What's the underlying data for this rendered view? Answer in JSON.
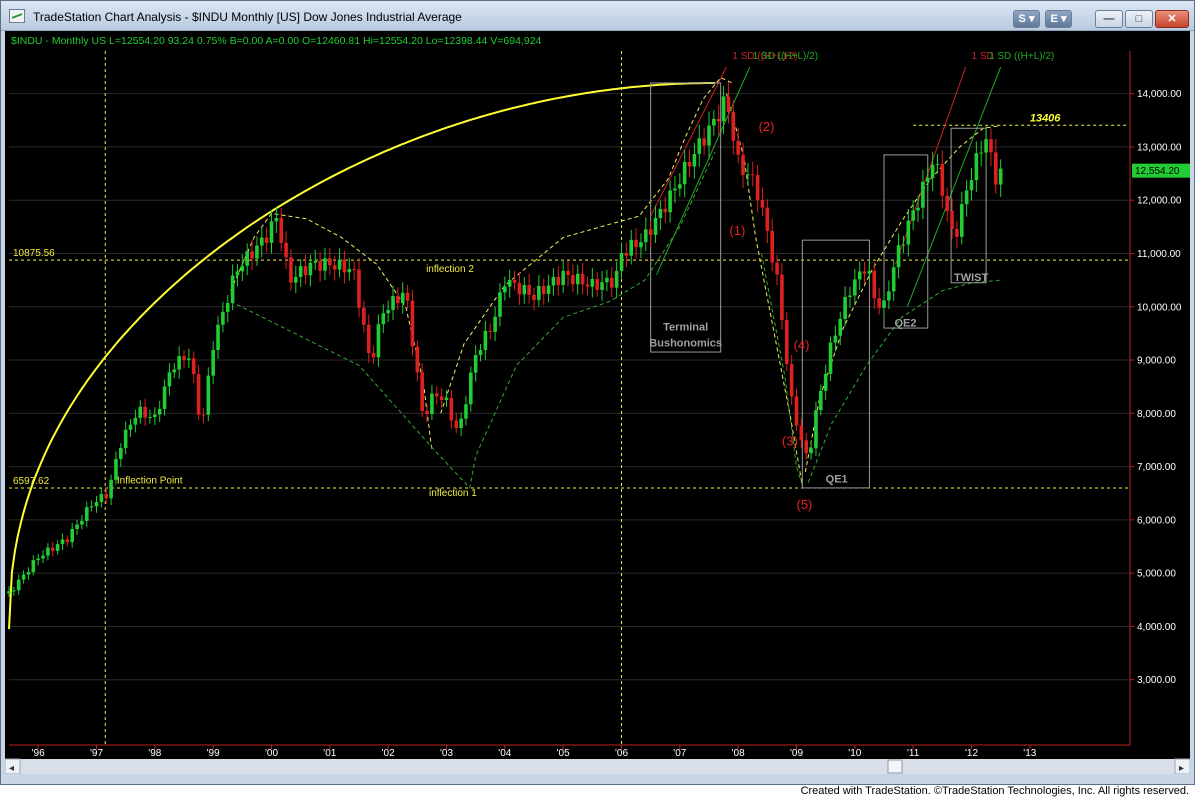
{
  "window": {
    "title": "TradeStation Chart Analysis - $INDU Monthly [US] Dow Jones Industrial Average",
    "buttons": {
      "s_label": "S",
      "e_label": "E"
    }
  },
  "header": {
    "info": "$INDU - Monthly  US  L=12554.20  93.24  0.75%  B=0.00  A=0.00  O=12460.81  Hi=12554.20  Lo=12398.44  V=694,924"
  },
  "colors": {
    "background": "#000000",
    "up": "#22cc33",
    "down": "#dd2020",
    "arc": "#ffff33",
    "dotted_yellow": "#eeee44",
    "dashed_green": "#33aa33",
    "grid": "#2a2a2a",
    "box": "#9a9a9a",
    "label_red": "#ee2020",
    "last_price_bg": "#22cc33"
  },
  "chart_data": {
    "type": "candlestick",
    "title": "",
    "xlabel": "",
    "ylabel": "",
    "ylim": [
      2000,
      14800
    ],
    "xlim": [
      1995.5,
      2014.7
    ],
    "x_ticks": [
      "'96",
      "'97",
      "'98",
      "'99",
      "'00",
      "'01",
      "'02",
      "'03",
      "'04",
      "'05",
      "'06",
      "'07",
      "'08",
      "'09",
      "'10",
      "'11",
      "'12",
      "'13"
    ],
    "x_tick_years": [
      1996,
      1997,
      1998,
      1999,
      2000,
      2001,
      2002,
      2003,
      2004,
      2005,
      2006,
      2007,
      2008,
      2009,
      2010,
      2011,
      2012,
      2013
    ],
    "y_ticks": [
      "3,000.00",
      "4,000.00",
      "5,000.00",
      "6,000.00",
      "7,000.00",
      "8,000.00",
      "9,000.00",
      "10,000.00",
      "11,000.00",
      "12,000.00",
      "13,000.00",
      "14,000.00"
    ],
    "y_tick_values": [
      3000,
      4000,
      5000,
      6000,
      7000,
      8000,
      9000,
      10000,
      11000,
      12000,
      13000,
      14000
    ],
    "last_price": {
      "label": "12,554.20",
      "value": 12554.2
    },
    "anchors": [
      [
        1995.5,
        4620
      ],
      [
        1996.0,
        5300
      ],
      [
        1996.5,
        5650
      ],
      [
        1996.92,
        6300
      ],
      [
        1997.2,
        6500
      ],
      [
        1997.4,
        7400
      ],
      [
        1997.7,
        8050
      ],
      [
        1998.0,
        7900
      ],
      [
        1998.3,
        8900
      ],
      [
        1998.6,
        9100
      ],
      [
        1998.8,
        7700
      ],
      [
        1999.0,
        9300
      ],
      [
        1999.4,
        10700
      ],
      [
        1999.9,
        11300
      ],
      [
        2000.1,
        11700
      ],
      [
        2000.3,
        10500
      ],
      [
        2000.7,
        10800
      ],
      [
        2001.0,
        10800
      ],
      [
        2001.4,
        10700
      ],
      [
        2001.7,
        8900
      ],
      [
        2001.9,
        9900
      ],
      [
        2002.3,
        10300
      ],
      [
        2002.6,
        7900
      ],
      [
        2002.8,
        8400
      ],
      [
        2003.0,
        8200
      ],
      [
        2003.2,
        7600
      ],
      [
        2003.5,
        9100
      ],
      [
        2003.8,
        9700
      ],
      [
        2004.0,
        10500
      ],
      [
        2004.5,
        10200
      ],
      [
        2005.0,
        10600
      ],
      [
        2005.5,
        10400
      ],
      [
        2005.9,
        10500
      ],
      [
        2006.0,
        11000
      ],
      [
        2006.4,
        11300
      ],
      [
        2006.8,
        12000
      ],
      [
        2007.2,
        12800
      ],
      [
        2007.6,
        13500
      ],
      [
        2007.8,
        13900
      ],
      [
        2008.0,
        12700
      ],
      [
        2008.3,
        12300
      ],
      [
        2008.5,
        11400
      ],
      [
        2008.7,
        10300
      ],
      [
        2008.9,
        8300
      ],
      [
        2009.1,
        7400
      ],
      [
        2009.2,
        7100
      ],
      [
        2009.35,
        8100
      ],
      [
        2009.6,
        9300
      ],
      [
        2009.9,
        10300
      ],
      [
        2010.2,
        10800
      ],
      [
        2010.35,
        10100
      ],
      [
        2010.5,
        10000
      ],
      [
        2010.7,
        10900
      ],
      [
        2010.9,
        11500
      ],
      [
        2011.2,
        12300
      ],
      [
        2011.35,
        12800
      ],
      [
        2011.5,
        12200
      ],
      [
        2011.7,
        11200
      ],
      [
        2011.8,
        11700
      ],
      [
        2012.0,
        12500
      ],
      [
        2012.25,
        13200
      ],
      [
        2012.4,
        12400
      ],
      [
        2012.5,
        12554
      ]
    ],
    "lines": {
      "h_upper": {
        "label": "10875.56",
        "value": 10875.56
      },
      "h_lower": {
        "label": "6597.62",
        "value": 6597.62
      },
      "h_resistance": {
        "label": "13406",
        "value": 13406
      },
      "v_dates": [
        1997.15,
        2006.0
      ]
    },
    "annotations": {
      "inflection_point": "Inflection Point",
      "inflection_1": "inflection 1",
      "inflection_2": "inflection 2",
      "terminal_line1": "Terminal",
      "terminal_line2": "Bushonomics",
      "qe1": "QE1",
      "qe2": "QE2",
      "twist": "TWIST",
      "wave_1": "(1)",
      "wave_2": "(2)",
      "wave_3": "(3)",
      "wave_4": "(4)",
      "wave_5": "(5)",
      "sd_label_1": "1 SD ((H+L)/2)",
      "sd_label_1b": "1 SD ((H+L)/2)",
      "sd_label_2": "1 SD",
      "sd_label_2b": "1 SD ((H+L)/2)"
    }
  },
  "footer": {
    "credit": "Created with TradeStation. ©TradeStation Technologies, Inc. All rights reserved."
  }
}
